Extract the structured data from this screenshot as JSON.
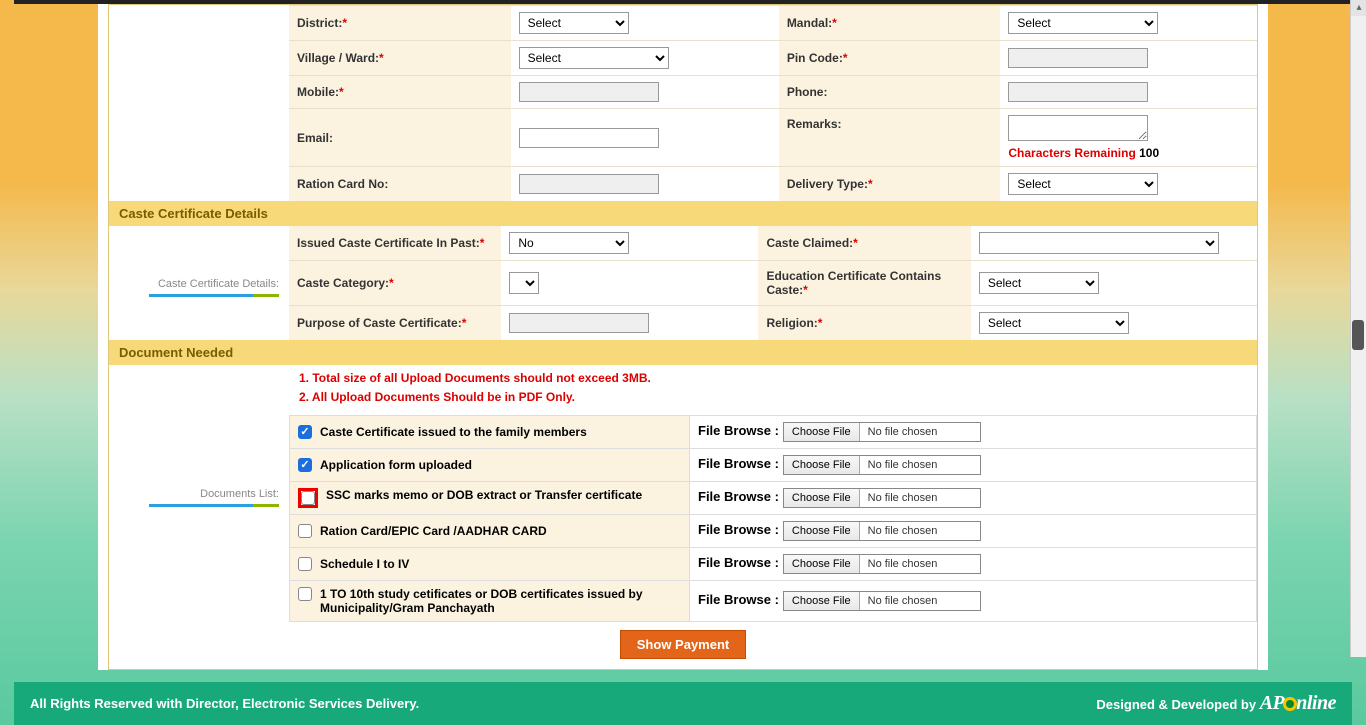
{
  "address": {
    "district_label": "District:",
    "district_select": "Select",
    "mandal_label": "Mandal:",
    "mandal_select": "Select",
    "village_label": "Village / Ward:",
    "village_select": "Select",
    "pincode_label": "Pin Code:",
    "mobile_label": "Mobile:",
    "phone_label": "Phone:",
    "email_label": "Email:",
    "remarks_label": "Remarks:",
    "chars_remain_label": "Characters Remaining ",
    "chars_remain_value": "100",
    "ration_label": "Ration Card No:",
    "delivery_label": "Delivery Type:",
    "delivery_select": "Select"
  },
  "caste": {
    "section_title": "Caste Certificate Details",
    "side_label": "Caste Certificate Details:",
    "issued_past_label": "Issued Caste Certificate In Past:",
    "issued_past_value": "No",
    "claimed_label": "Caste Claimed:",
    "category_label": "Caste Category:",
    "edu_contains_label": "Education Certificate Contains Caste:",
    "edu_contains_value": "Select",
    "purpose_label": "Purpose of Caste Certificate:",
    "religion_label": "Religion:",
    "religion_value": "Select"
  },
  "documents": {
    "section_title": "Document Needed",
    "side_label": "Documents List:",
    "note1": "1. Total size of all Upload Documents should not exceed 3MB.",
    "note2": "2. All Upload Documents Should be in PDF Only.",
    "file_browse_label": "File Browse :",
    "choose_btn": "Choose File",
    "no_file": "No file chosen",
    "items": [
      {
        "label": "Caste Certificate issued to the family members",
        "checked": true
      },
      {
        "label": "Application form uploaded",
        "checked": true
      },
      {
        "label": "SSC marks memo or DOB extract or Transfer certificate",
        "checked": false,
        "highlight": true
      },
      {
        "label": "Ration Card/EPIC Card /AADHAR CARD",
        "checked": false
      },
      {
        "label": "Schedule I to IV",
        "checked": false
      },
      {
        "label": "1 TO 10th study cetificates or DOB certificates issued by Municipality/Gram Panchayath",
        "checked": false
      }
    ]
  },
  "button": {
    "show_payment": "Show Payment"
  },
  "footer": {
    "left": "All Rights Reserved with Director, Electronic Services Delivery.",
    "right_prefix": "Designed & Developed by "
  }
}
